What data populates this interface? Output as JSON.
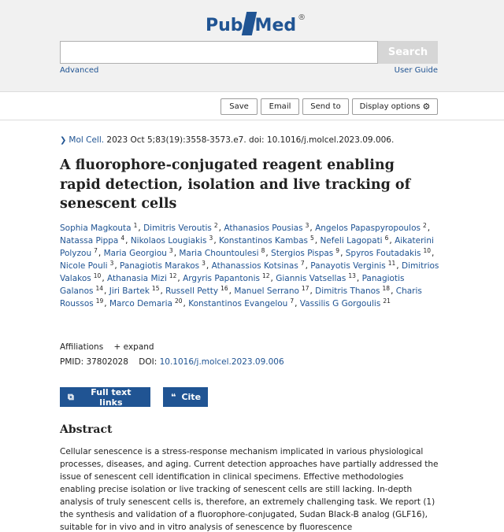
{
  "logo": {
    "pub": "Pub",
    "med": "Med",
    "reg": "®"
  },
  "search": {
    "value": "",
    "placeholder": "",
    "button_label": "Search",
    "advanced_label": "Advanced",
    "user_guide_label": "User Guide"
  },
  "actions": {
    "save": "Save",
    "email": "Email",
    "send_to": "Send to",
    "display_options": "Display options"
  },
  "citation": {
    "journal": "Mol Cell.",
    "details": " 2023 Oct 5;83(19):3558-3573.e7. doi: 10.1016/j.molcel.2023.09.006."
  },
  "title": "A fluorophore-conjugated reagent enabling rapid detection, isolation and live tracking of senescent cells",
  "authors": [
    {
      "name": "Sophia Magkouta",
      "aff": "1"
    },
    {
      "name": "Dimitris Veroutis",
      "aff": "2"
    },
    {
      "name": "Athanasios Pousias",
      "aff": "3"
    },
    {
      "name": "Angelos Papaspyropoulos",
      "aff": "2"
    },
    {
      "name": "Natassa Pippa",
      "aff": "4"
    },
    {
      "name": "Nikolaos Lougiakis",
      "aff": "3"
    },
    {
      "name": "Konstantinos Kambas",
      "aff": "5"
    },
    {
      "name": "Nefeli Lagopati",
      "aff": "6"
    },
    {
      "name": "Aikaterini Polyzou",
      "aff": "7"
    },
    {
      "name": "Maria Georgiou",
      "aff": "3"
    },
    {
      "name": "Maria Chountoulesi",
      "aff": "8"
    },
    {
      "name": "Stergios Pispas",
      "aff": "9"
    },
    {
      "name": "Spyros Foutadakis",
      "aff": "10"
    },
    {
      "name": "Nicole Pouli",
      "aff": "3"
    },
    {
      "name": "Panagiotis Marakos",
      "aff": "3"
    },
    {
      "name": "Athanassios Kotsinas",
      "aff": "7"
    },
    {
      "name": "Panayotis Verginis",
      "aff": "11"
    },
    {
      "name": "Dimitrios Valakos",
      "aff": "10"
    },
    {
      "name": "Athanasia Mizi",
      "aff": "12"
    },
    {
      "name": "Argyris Papantonis",
      "aff": "12"
    },
    {
      "name": "Giannis Vatsellas",
      "aff": "13"
    },
    {
      "name": "Panagiotis Galanos",
      "aff": "14"
    },
    {
      "name": "Jiri Bartek",
      "aff": "15"
    },
    {
      "name": "Russell Petty",
      "aff": "16"
    },
    {
      "name": "Manuel Serrano",
      "aff": "17"
    },
    {
      "name": "Dimitris Thanos",
      "aff": "18"
    },
    {
      "name": "Charis Roussos",
      "aff": "19"
    },
    {
      "name": "Marco Demaria",
      "aff": "20"
    },
    {
      "name": "Konstantinos Evangelou",
      "aff": "7"
    },
    {
      "name": "Vassilis G Gorgoulis",
      "aff": "21"
    }
  ],
  "affiliations": {
    "label": "Affiliations",
    "expand": "+ expand"
  },
  "ids": {
    "pmid_label": "PMID: 37802028",
    "doi_label": "DOI:",
    "doi_value": "10.1016/j.molcel.2023.09.006"
  },
  "buttons": {
    "full_text": "Full text links",
    "cite": "Cite"
  },
  "abstract": {
    "heading": "Abstract",
    "text": "Cellular senescence is a stress-response mechanism implicated in various physiological processes, diseases, and aging. Current detection approaches have partially addressed the issue of senescent cell identification in clinical specimens. Effective methodologies enabling precise isolation or live tracking of senescent cells are still lacking. In-depth analysis of truly senescent cells is, therefore, an extremely challenging task. We report (1) the synthesis and validation of a fluorophore-conjugated, Sudan Black-B analog (GLF16), suitable for in vivo and in vitro analysis of senescence by fluorescence"
  }
}
